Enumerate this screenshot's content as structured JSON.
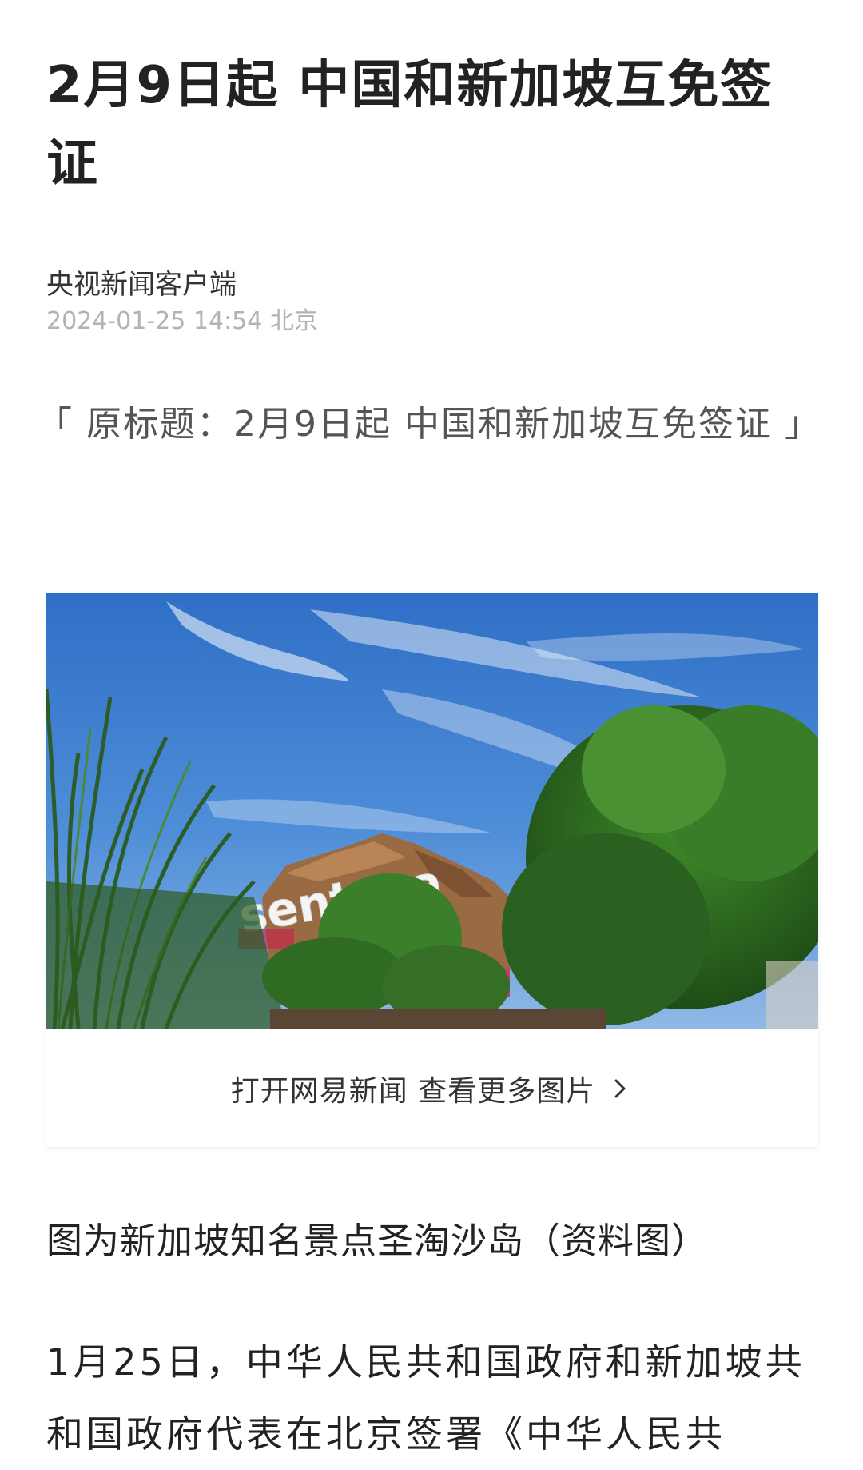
{
  "article": {
    "headline": "2月9日起 中国和新加坡互免签证",
    "source": "央视新闻客户端",
    "meta": "2024-01-25 14:54 北京",
    "original_title": "「 原标题：2月9日起 中国和新加坡互免签证 」",
    "photo": {
      "sign_text": "sentosa",
      "more_label": "打开网易新闻 查看更多图片",
      "chevron_icon": "chevron-right-icon"
    },
    "caption": "图为新加坡知名景点圣淘沙岛（资料图）",
    "paragraph": "1月25日，中华人民共和国政府和新加坡共和国政府代表在北京签署《中华人民共"
  },
  "colors": {
    "headline": "#222222",
    "meta": "#b3b3b3",
    "sky": "#3b76c9",
    "foliage": "#2f6b22"
  }
}
